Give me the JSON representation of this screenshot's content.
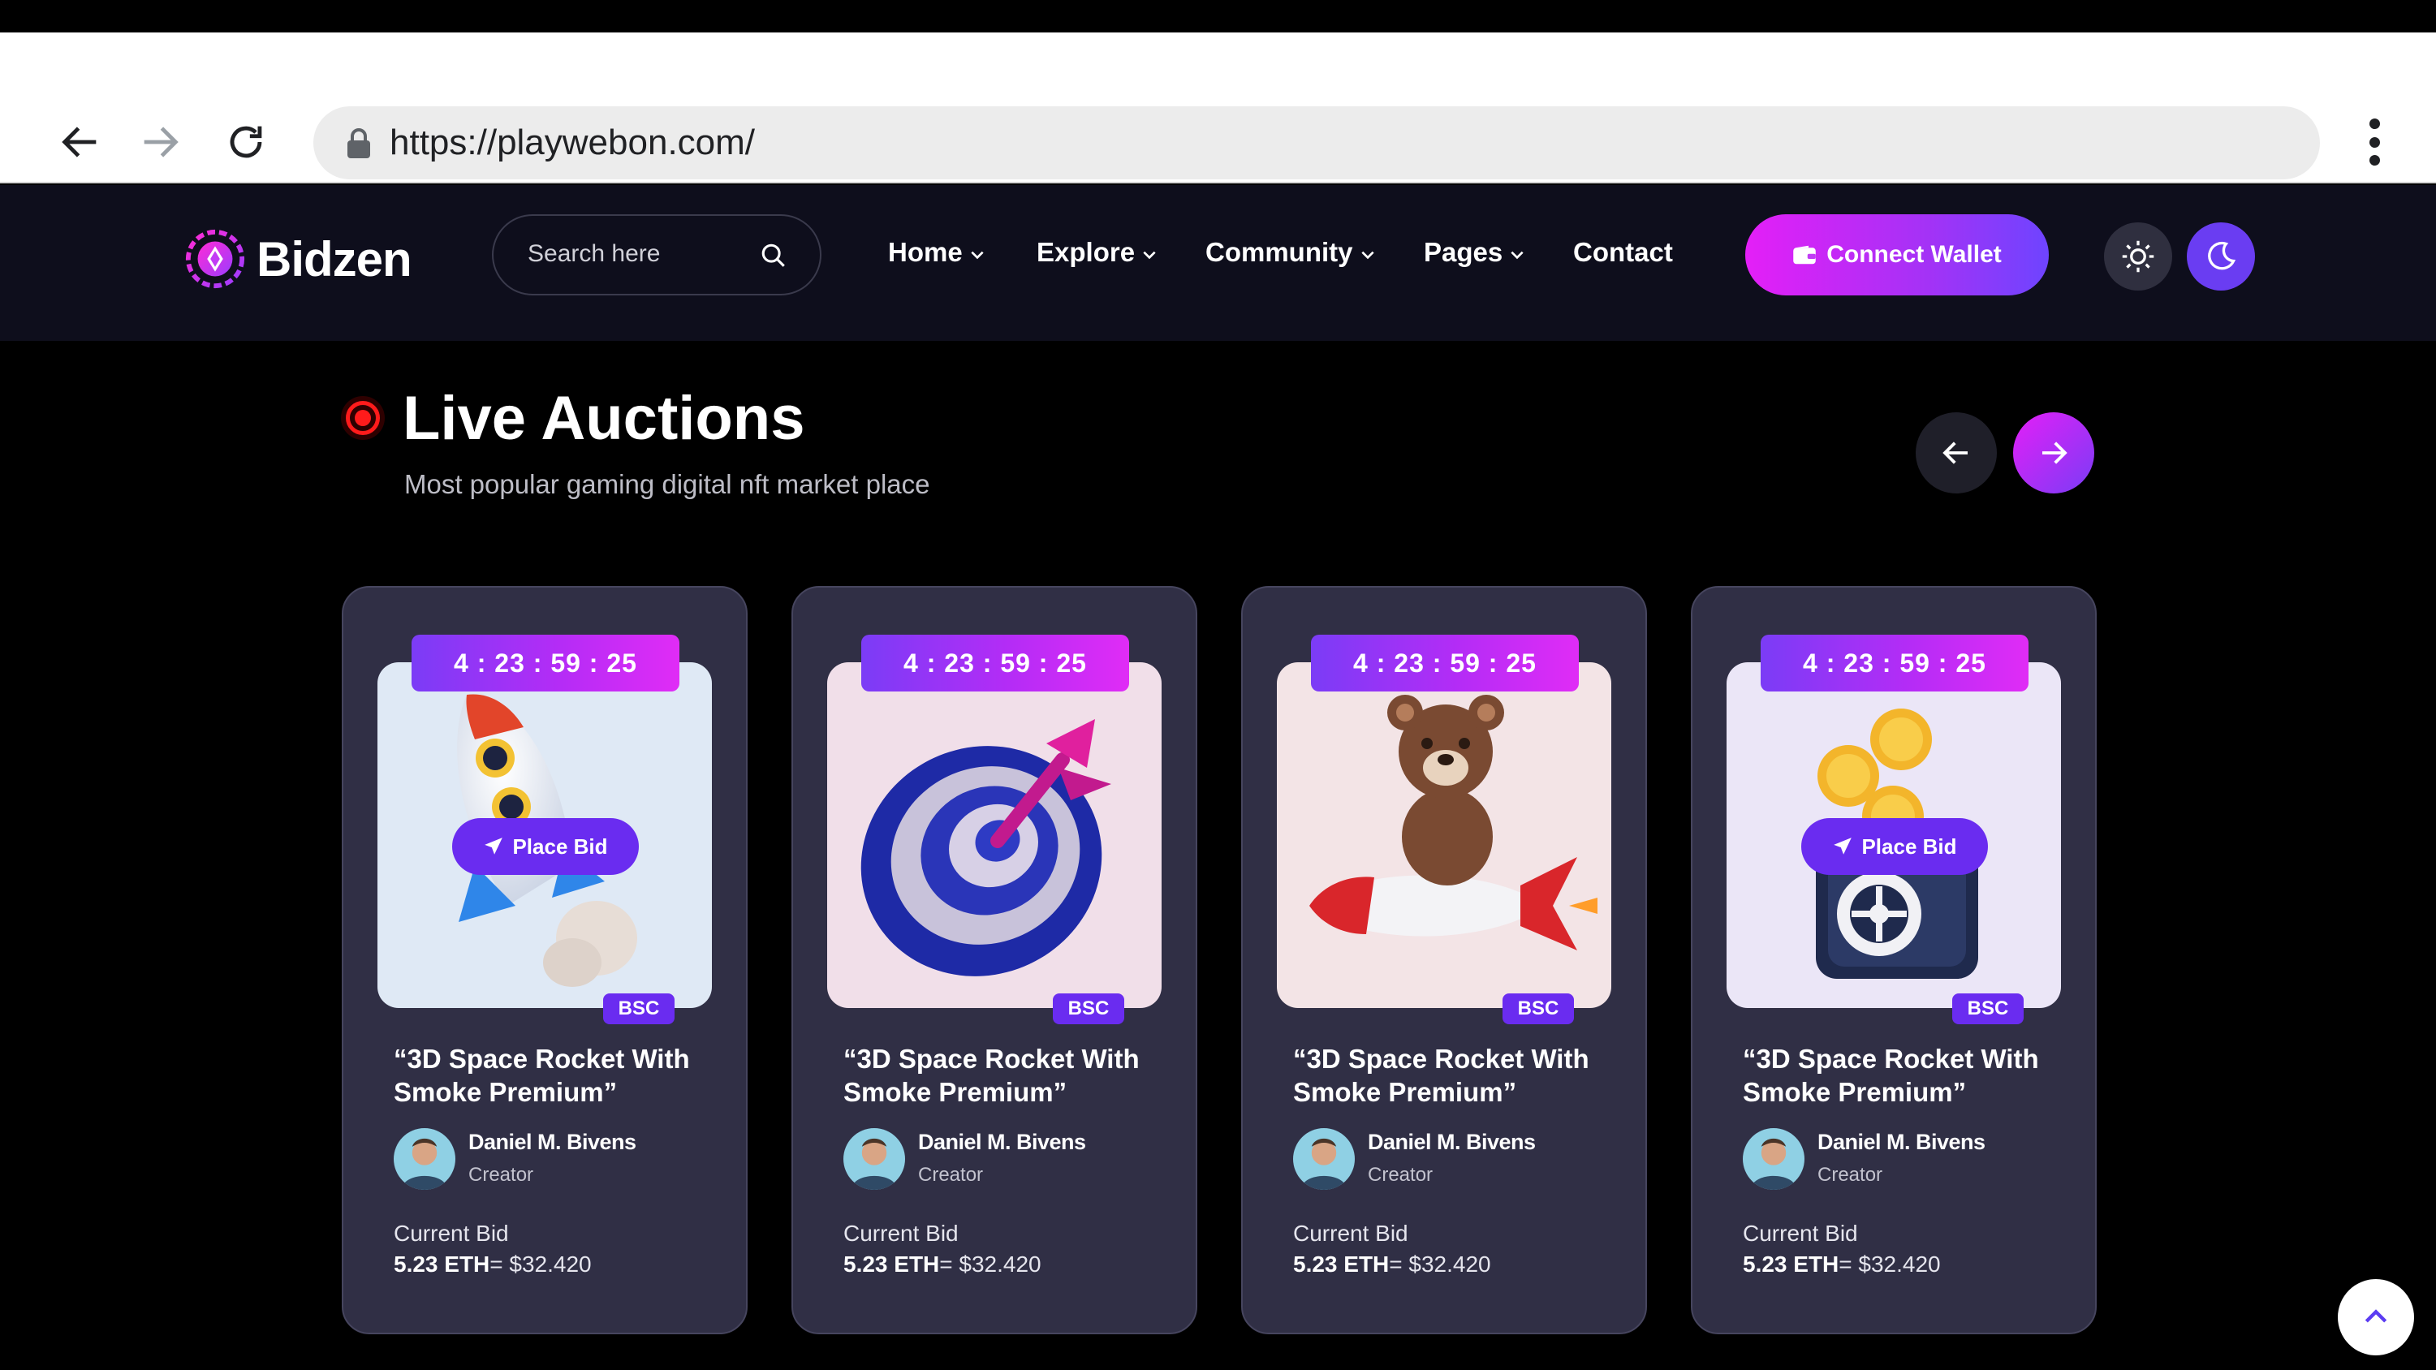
{
  "browser": {
    "url": "https://playwebon.com/"
  },
  "header": {
    "logo_text": "Bidzen",
    "search_placeholder": "Search here",
    "nav": [
      {
        "label": "Home",
        "has_dropdown": true
      },
      {
        "label": "Explore",
        "has_dropdown": true
      },
      {
        "label": "Community",
        "has_dropdown": true
      },
      {
        "label": "Pages",
        "has_dropdown": true
      },
      {
        "label": "Contact",
        "has_dropdown": false
      }
    ],
    "connect_wallet_label": "Connect Wallet",
    "theme_modes": [
      "light",
      "dark"
    ]
  },
  "section": {
    "title": "Live Auctions",
    "subtitle": "Most popular gaming digital nft market place"
  },
  "colors": {
    "accent_gradient_start": "#e41ff7",
    "accent_gradient_end": "#6e44ff",
    "card_bg": "#302f45",
    "badge": "#6a2cf0",
    "live_red": "#ff1b1b"
  },
  "cards": [
    {
      "timer": "4 : 23 : 59 : 25",
      "art": "rocket",
      "place_bid_label": "Place Bid",
      "chain": "BSC",
      "title": "“3D Space Rocket With Smoke Premium”",
      "creator_name": "Daniel M. Bivens",
      "creator_role": "Creator",
      "bid_label": "Current Bid",
      "bid_eth": "5.23 ETH",
      "bid_usd": "= $32.420"
    },
    {
      "timer": "4 : 23 : 59 : 25",
      "art": "dartboard",
      "place_bid_label": "",
      "chain": "BSC",
      "title": "“3D Space Rocket With Smoke Premium”",
      "creator_name": "Daniel M. Bivens",
      "creator_role": "Creator",
      "bid_label": "Current Bid",
      "bid_eth": "5.23 ETH",
      "bid_usd": "= $32.420"
    },
    {
      "timer": "4 : 23 : 59 : 25",
      "art": "teddy-bear-on-rocket",
      "place_bid_label": "",
      "chain": "BSC",
      "title": "“3D Space Rocket With Smoke Premium”",
      "creator_name": "Daniel M. Bivens",
      "creator_role": "Creator",
      "bid_label": "Current Bid",
      "bid_eth": "5.23 ETH",
      "bid_usd": "= $32.420"
    },
    {
      "timer": "4 : 23 : 59 : 25",
      "art": "coins-and-safe",
      "place_bid_label": "Place Bid",
      "chain": "BSC",
      "title": "“3D Space Rocket With Smoke Premium”",
      "creator_name": "Daniel M. Bivens",
      "creator_role": "Creator",
      "bid_label": "Current Bid",
      "bid_eth": "5.23 ETH",
      "bid_usd": "= $32.420"
    }
  ]
}
